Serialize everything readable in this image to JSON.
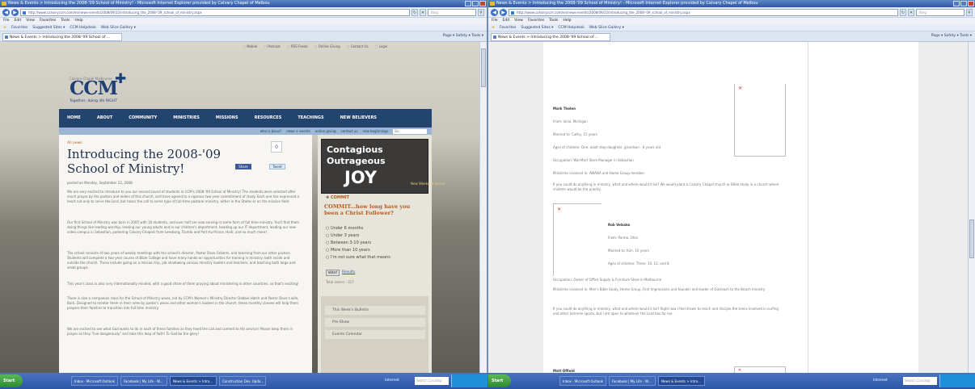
{
  "left_window": {
    "title": "News & Events > Introducing the 2008-'09 School of Ministry! - Microsoft Internet Explorer provided by Calvary Chapel of Melbou",
    "url": "http://www.calvaryccm.com/en/news-events/2008/09/22/introducing_the_2008-'09_school_of_ministry.aspx",
    "search_placeholder": "Bing",
    "menu": [
      "File",
      "Edit",
      "View",
      "Favorites",
      "Tools",
      "Help"
    ],
    "favorites": [
      "Favorites",
      "Suggested Sites ▾",
      "CCM Helpdesk",
      "Web Slice Gallery ▾"
    ],
    "tab_title": "News & Events > Introducing the 2008-'09 School of ...",
    "toolbar": "Page ▾  Safety ▾  Tools ▾"
  },
  "site": {
    "top_links": [
      "Mobile",
      "Podcast",
      "RSS Feeds",
      "Online Giving",
      "Contact Us",
      "Login"
    ],
    "logo_tag": "Calvary Chapel Melbourne",
    "logo_text": "CCM",
    "logo_motto": "Together, doing life RIGHT",
    "nav": [
      "HOME",
      "ABOUT",
      "COMMUNITY",
      "MINISTRIES",
      "MISSIONS",
      "RESOURCES",
      "TEACHINGS",
      "NEW BELIEVERS"
    ],
    "subnav": [
      "who is Jesus?",
      "news + events",
      "online giving",
      "contact us",
      "new beginnings"
    ],
    "subnav_search": "Go"
  },
  "article": {
    "crumb": "All news",
    "title": "Introducing the 2008-'09 School of Ministry!",
    "share_count": "0",
    "share_label": "Share",
    "tweet_label": "Tweet",
    "posted": "posted on Monday, September 22, 2008",
    "paragraphs": [
      "We are very excited to introduce to you our second round of students in CCM's 2008-'09 School of Ministry! The students were selected after much prayer by the pastors and elders of this church, and have agreed to a rigorous two-year commitment of study. Each one has expressed a heart not only to serve the Lord, but hears the call to some type of full-time pastoral ministry, either in the States or on the mission field.",
      "Our first School of Ministry was born in 2005 with 16 students, and over half are now serving in some form of full time ministry. You'll find them doing things like leading worship, leading our young adults and in our children's department, heading up our IT department, leading our new video campus in Sebastian, pastoring Calvary Chapels from Leesburg, Florida and Port-Au-Prince, Haiti, and so much more!",
      "The school consists of two years of weekly meetings with the school's director, Pastor Dave Folkerts, and teaching from our other pastors. Students will complete a two-year course of Bible College and have many hands-on opportunities for training in ministry, both inside and outside the church. These include going on a mission trip, job shadowing various ministry leaders and teachers, and teaching both large and small groups.",
      "This year's class is also very internationally minded, with a good share of them praying about ministering in other countries, so that's exciting!",
      "There is also a companion class for the School of Ministry wives, led by CCM's Women's Ministry Director Debbie Hatch and Pastor Dave's wife, Barb. Designed to mentor them in their roles by pastor's wives and other women's leaders in the church, these monthly classes will help them prepare their families to transition into full time ministry.",
      "We are excited to see what God wants to do in each of these families as they heed the call and commit to His service! Please keep them in prayer as they \"live dangerously\" and take this leap of faith! To God be the glory!"
    ]
  },
  "sidebar": {
    "promo": [
      "Contagious",
      "Outrageous",
      "JOY",
      "New Weekend Series"
    ],
    "commit_label": "COMMIT",
    "poll_question": "COMMIT...how long have you been a Christ Follower?",
    "poll_options": [
      "Under 6 months",
      "Under 3 years",
      "Between 3-10 years",
      "More than 10 years",
      "I'm not sure what that means"
    ],
    "vote": "Vote!",
    "results": "Results",
    "total_votes": "Total voters : 317",
    "links": [
      "This Week's Bulletin",
      "Pre-Show",
      "Events Calendar"
    ]
  },
  "right_window": {
    "title": "News & Events > Introducing the 2008-'09 School of Ministry! - Microsoft Internet Explorer provided by Calvary Chapel of Melbou",
    "url": "http://www.calvaryccm.com/en/news-events/2008/09/22/introducing_the_2008-'09_school_of_ministry.aspx",
    "search_placeholder": "Bing",
    "menu": [
      "File",
      "Edit",
      "View",
      "Favorites",
      "Tools",
      "Help"
    ],
    "favorites": [
      "Favorites",
      "Suggested Sites ▾",
      "CCM Helpdesk",
      "Web Slice Gallery ▾"
    ],
    "tab_title": "News & Events > Introducing the 2008-'09 School of ...",
    "toolbar": "Page ▾  Safety ▾  Tools ▾"
  },
  "profiles": {
    "p1": {
      "name": "Mark Thelen",
      "from": "From: Ionia, Michigan",
      "married": "Married to: Cathy, 15 years",
      "children": "Ages of children: One: adult step-daughter, grandson - 9 years old",
      "occupation": "Occupation: Wal-Mart Store Manager in Sebastian",
      "ministries": "Ministries involved in: AWANA and Home Group member",
      "question": "If you could do anything in ministry, what and where would it be? We would plant a Calvary Chapel church or Bible study in a church where children would be the priority."
    },
    "p2": {
      "name": "Rob Velasko",
      "from": "From: Parma, Ohio",
      "married": "Married to: Kim, 10 years",
      "children": "Ages of children: Three: 10, 12, and 8",
      "occupation": "Occupation: Owner of Office Supply & Furniture Store in Melbourne",
      "ministries": "Ministries involved in: Men's Bible Study, Home Group, First Impressions and founder and leader of Outreach to the Beach ministry",
      "question": "If you could do anything in ministry, what and where would it be? Right now I feel drawn to reach and disciple the teens involved in surfing and other extreme sports, but I am open to whatever the Lord has for me."
    },
    "p3_name": "Matt Offield"
  },
  "taskbar": {
    "start": "Start",
    "left_items": [
      "Inbox - Microsoft Outlook",
      "Facebook | My Life - W...",
      "News & Events > Intro...",
      "Construction Dev. Upda..."
    ],
    "right_items": [
      "Inbox - Microsoft Outlook",
      "Facebook | My Life - W...",
      "News & Events > Intro..."
    ],
    "zone": "Internet",
    "zoom": "100%",
    "search": "Search Desktop"
  }
}
